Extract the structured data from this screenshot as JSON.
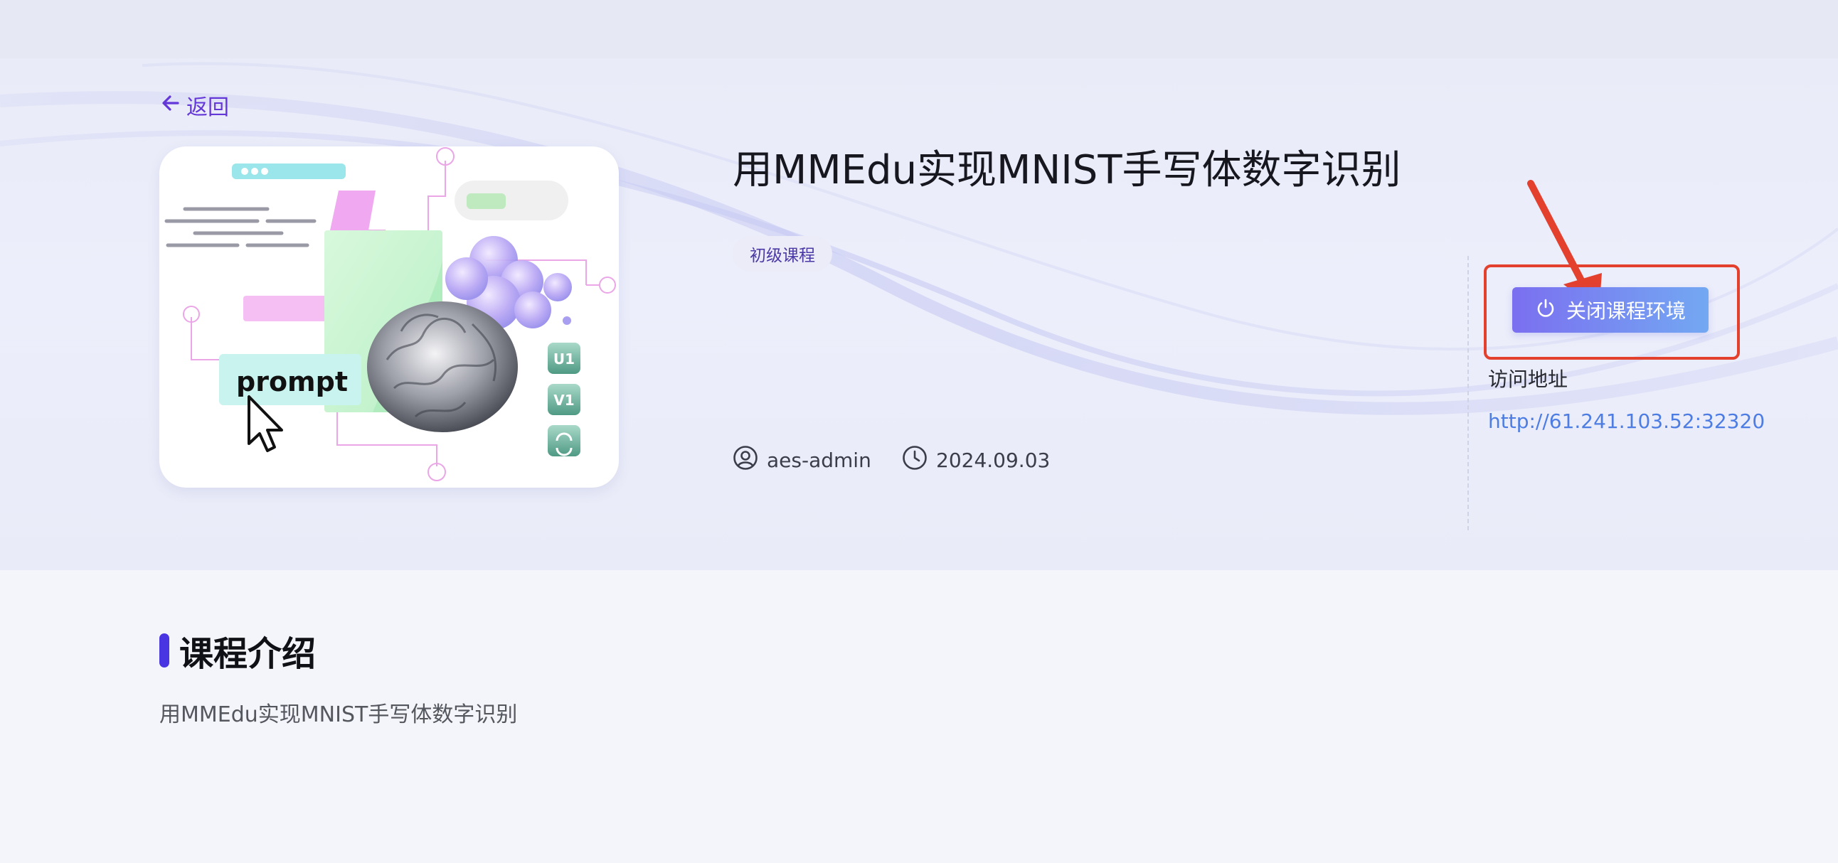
{
  "nav": {
    "back_label": "返回"
  },
  "course": {
    "title": "用MMEdu实现MNIST手写体数字识别",
    "level_tag": "初级课程",
    "author": "aes-admin",
    "date": "2024.09.03",
    "cover": {
      "prompt_text": "prompt",
      "side_buttons": [
        "U1",
        "V1"
      ]
    }
  },
  "environment": {
    "close_button_label": "关闭课程环境",
    "access_label": "访问地址",
    "access_url": "http://61.241.103.52:32320"
  },
  "intro": {
    "heading": "课程介绍",
    "text": "用MMEdu实现MNIST手写体数字识别"
  },
  "colors": {
    "accent": "#6437d8",
    "highlight_border": "#e4402e",
    "button_gradient_start": "#7b6ff0",
    "button_gradient_end": "#73a8f2",
    "link": "#4d7de3"
  },
  "icons": {
    "back": "arrow-left-icon",
    "power": "power-icon",
    "user": "user-circle-icon",
    "clock": "clock-icon",
    "annotation": "red-arrow-annotation"
  }
}
